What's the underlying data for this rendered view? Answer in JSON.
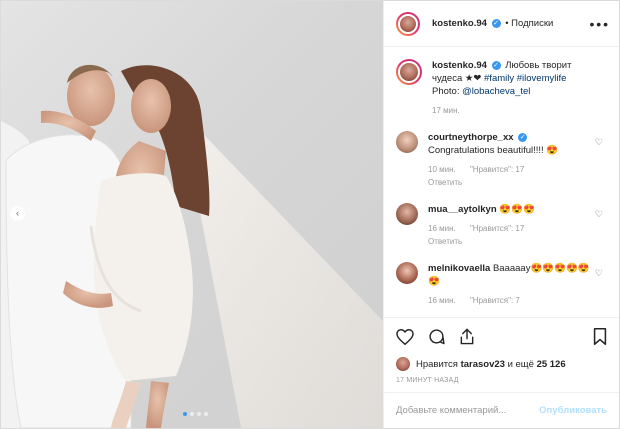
{
  "post": {
    "username": "kostenko.94",
    "separator": "•",
    "follow_label": "Подписки",
    "more_icon": "more-horizontal-icon"
  },
  "caption": {
    "username": "kostenko.94",
    "text": "Любовь творит чудеса",
    "emoji": "★❤",
    "hashtags": "#family #ilovemylife",
    "photo_prefix": "Photo:",
    "photo_credit": "@lobacheva_tel",
    "time": "17 мин."
  },
  "comments": [
    {
      "username": "courtneythorpe_xx",
      "verified": true,
      "text": "Congratulations beautiful!!!! 😍",
      "time": "10 мин.",
      "likes": "\"Нравится\": 17",
      "reply": "Ответить"
    },
    {
      "username": "mua__aytolkyn",
      "verified": false,
      "text": "😍😍😍",
      "time": "16 мин.",
      "likes": "\"Нравится\": 17",
      "reply": "Ответить"
    },
    {
      "username": "melnikovaella",
      "verified": false,
      "text": "Ваааааy😍😍😍😍😍😍",
      "time": "16 мин.",
      "likes": "\"Нравится\": 7",
      "reply": ""
    }
  ],
  "likes": {
    "prefix": "Нравится",
    "user": "tarasov23",
    "suffix": "и ещё",
    "count": "25 126"
  },
  "timestamp": "17 МИНУТ НАЗАД",
  "add_comment": {
    "placeholder": "Добавьте комментарий...",
    "publish": "Опубликовать"
  },
  "carousel": {
    "current": 1,
    "total": 4
  },
  "colors": {
    "accent": "#3897f0",
    "link": "#003569",
    "publish_disabled": "#b2dffc"
  }
}
